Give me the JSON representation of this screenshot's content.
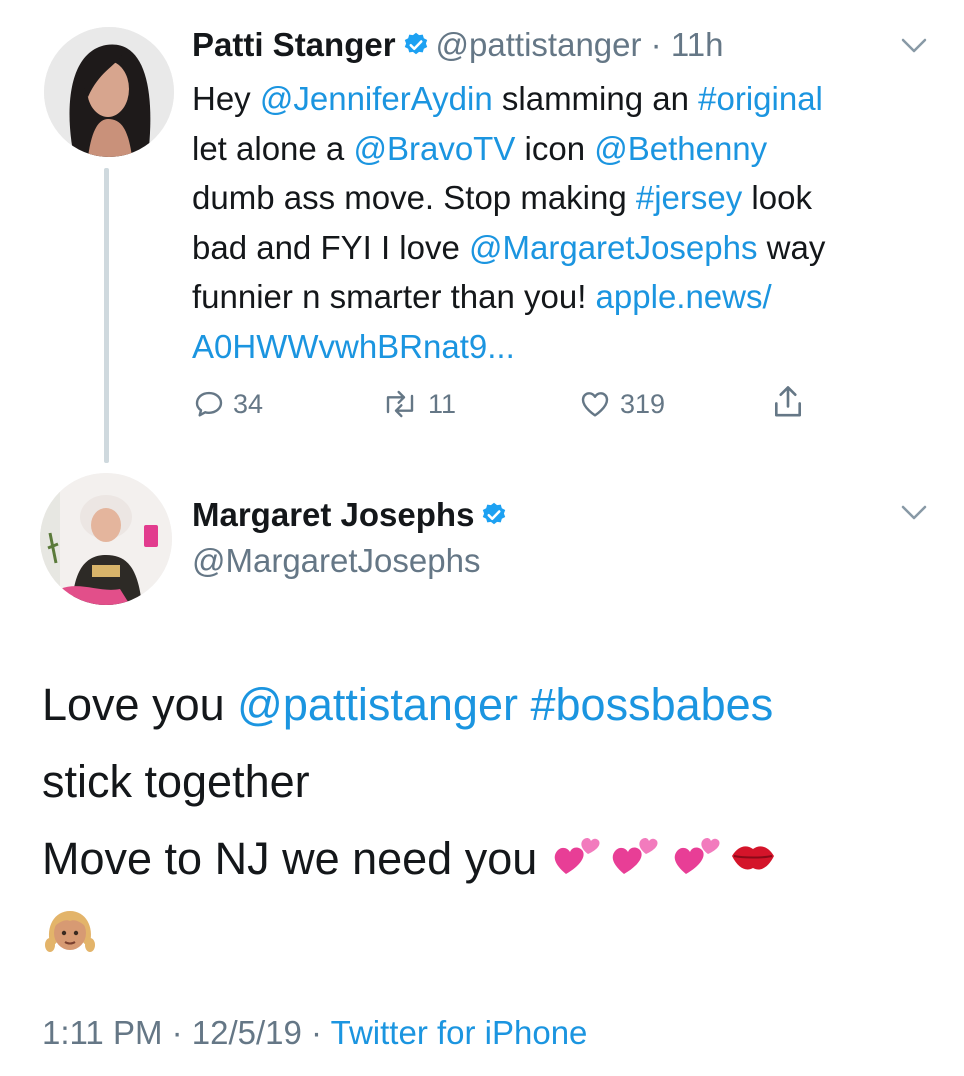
{
  "tweet1": {
    "name": "Patti Stanger",
    "handle": "@pattistanger",
    "sep": " · ",
    "time": "11h",
    "body": {
      "line1_a": "Hey ",
      "line1_mention": "@JenniferAydin",
      "line1_b": " slamming an ",
      "line1_tag": "#original",
      "line2_a": "let alone a ",
      "line2_mention1": "@BravoTV",
      "line2_b": " icon ",
      "line2_mention2": "@Bethenny",
      "line3_a": "dumb ass move. Stop making ",
      "line3_tag": "#jersey",
      "line3_b": " look",
      "line4_a": "bad and FYI I love ",
      "line4_mention": "@MargaretJosephs",
      "line4_b": " way",
      "line5_a": "funnier n smarter than you! ",
      "line5_link": "apple.news/",
      "line6_link": "A0HWWvwhBRnat9..."
    },
    "reply_count": "34",
    "retweet_count": "11",
    "like_count": "319"
  },
  "tweet2": {
    "name": "Margaret Josephs",
    "handle": "@MargaretJosephs",
    "body": {
      "line1_a": "Love you ",
      "line1_mention": "@pattistanger",
      "line1_sp": " ",
      "line1_tag": "#bossbabes",
      "line2": "stick together",
      "line3": "Move to NJ we need you "
    },
    "time": "1:11 PM",
    "sep": " · ",
    "date": "12/5/19",
    "sep2": " · ",
    "source": "Twitter for iPhone"
  },
  "colors": {
    "link": "#1b95e0",
    "muted": "#657786",
    "text": "#14171a",
    "verified": "#1da1f2",
    "thread_line": "#cfd9de"
  },
  "icons": [
    "verified-badge-icon",
    "chevron-down-icon",
    "reply-icon",
    "retweet-icon",
    "like-icon",
    "share-icon",
    "two-hearts-emoji",
    "kiss-mark-emoji",
    "girl-emoji"
  ]
}
